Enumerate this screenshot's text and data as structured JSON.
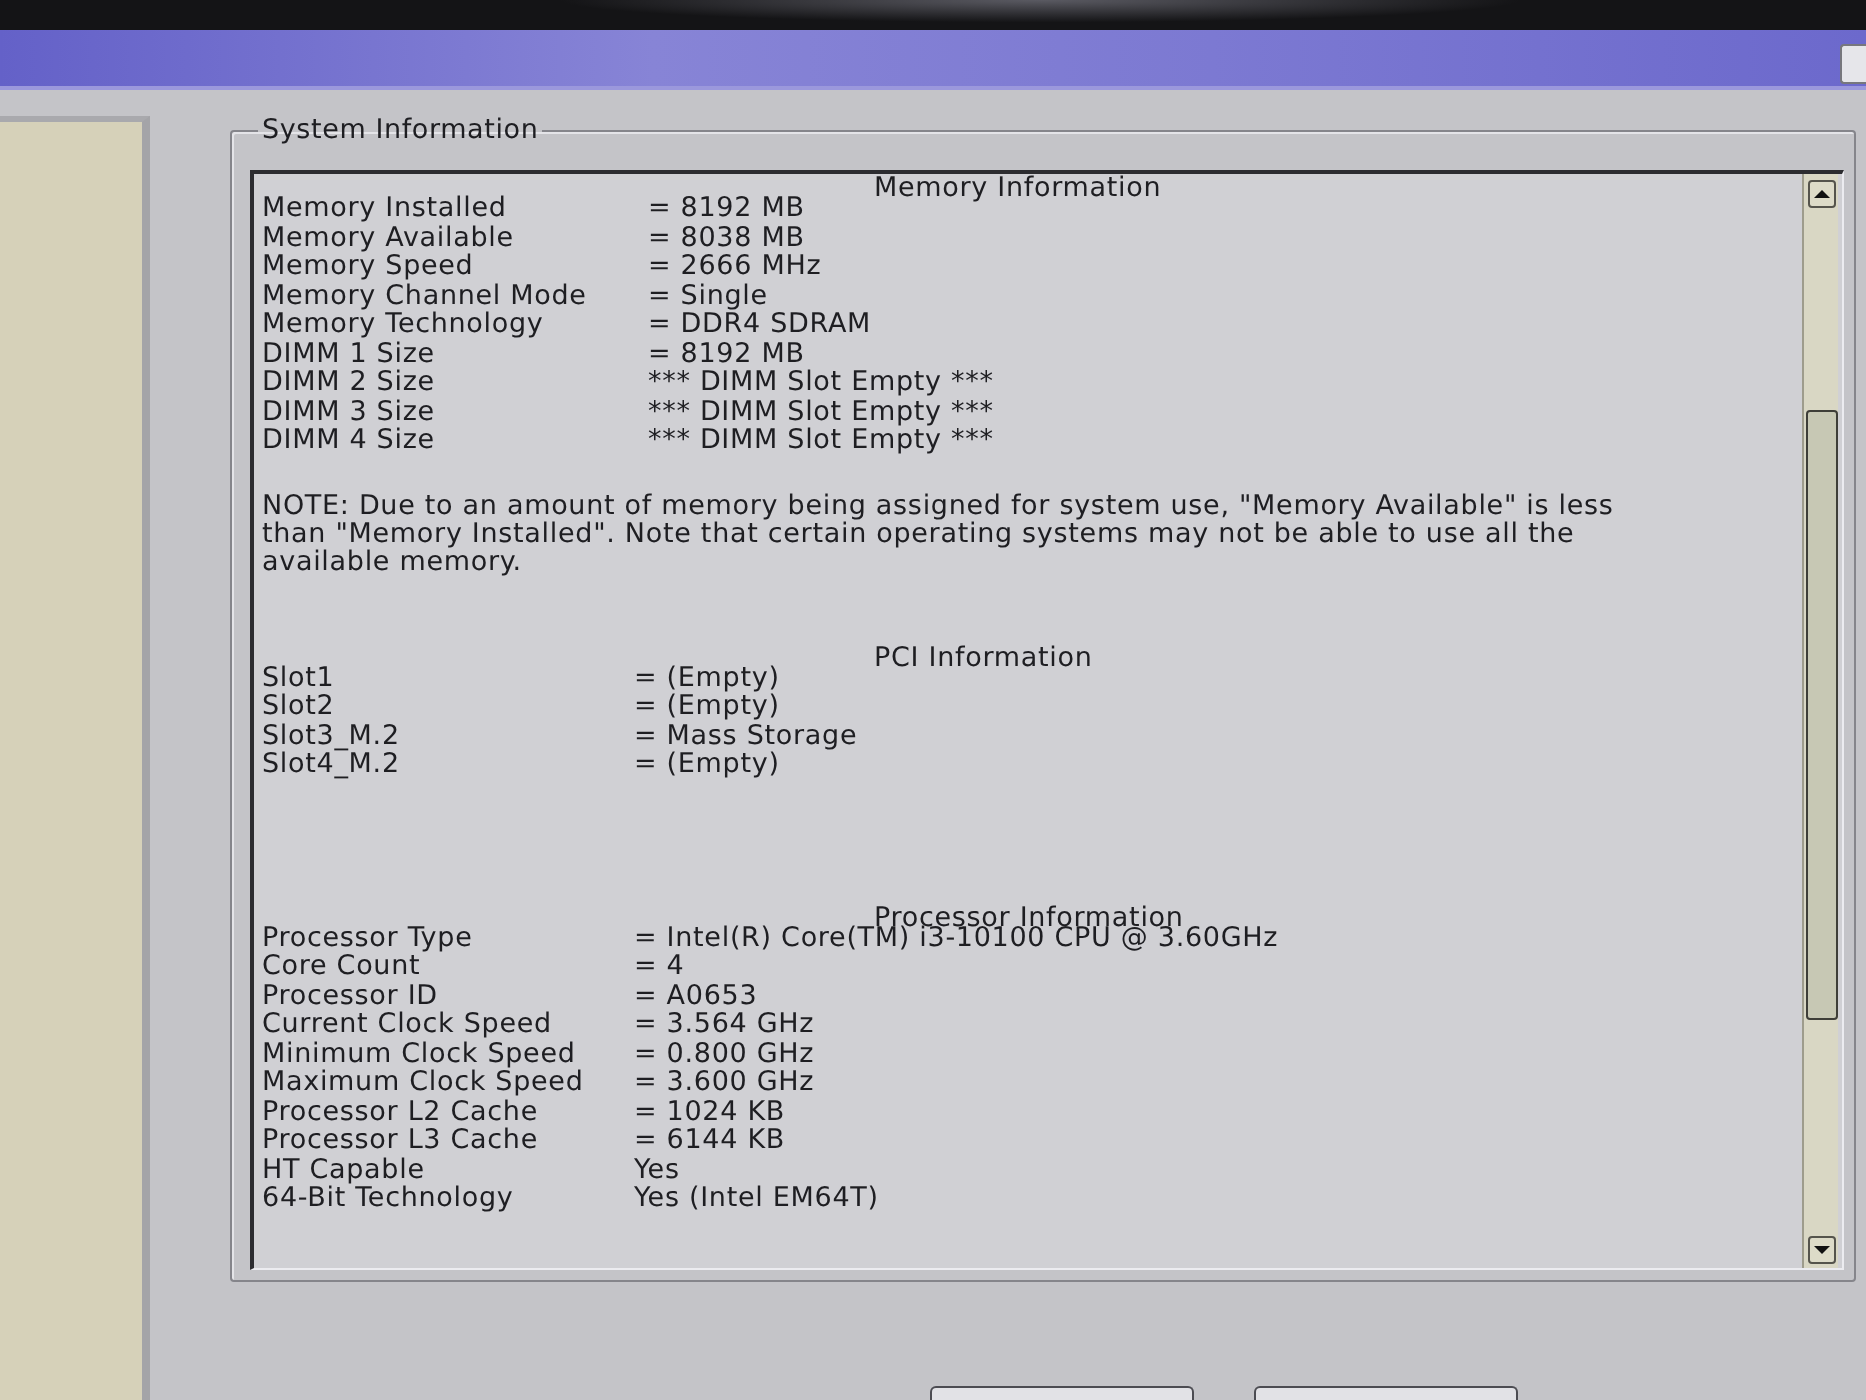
{
  "group": {
    "title": "System Information"
  },
  "sections": [
    {
      "kind": "table",
      "heading": "Memory Information",
      "rows": [
        {
          "label": "Memory Installed",
          "value": "= 8192 MB"
        },
        {
          "label": "Memory Available",
          "value": "= 8038 MB"
        },
        {
          "label": "Memory Speed",
          "value": "= 2666 MHz"
        },
        {
          "label": "Memory Channel Mode",
          "value": "= Single"
        },
        {
          "label": "Memory Technology",
          "value": "= DDR4 SDRAM"
        },
        {
          "label": "DIMM 1 Size",
          "value": "= 8192 MB"
        },
        {
          "label": "DIMM 2 Size",
          "value": "*** DIMM Slot Empty ***"
        },
        {
          "label": "DIMM 3 Size",
          "value": "*** DIMM Slot Empty ***"
        },
        {
          "label": "DIMM 4 Size",
          "value": "*** DIMM Slot Empty ***"
        }
      ]
    },
    {
      "kind": "note",
      "text": "NOTE: Due to an amount of memory being assigned for system use, \"Memory Available\" is less than \"Memory Installed\". Note that certain operating systems may not be able to use all the available memory."
    },
    {
      "kind": "table",
      "heading": "PCI Information",
      "rows": [
        {
          "label": "Slot1",
          "value": "= (Empty)"
        },
        {
          "label": "Slot2",
          "value": "= (Empty)"
        },
        {
          "label": "Slot3_M.2",
          "value": "= Mass Storage"
        },
        {
          "label": "Slot4_M.2",
          "value": "= (Empty)"
        }
      ]
    },
    {
      "kind": "table",
      "heading": "Processor Information",
      "rows": [
        {
          "label": "Processor Type",
          "value": "= Intel(R) Core(TM) i3-10100 CPU @ 3.60GHz"
        },
        {
          "label": "Core Count",
          "value": "= 4"
        },
        {
          "label": "Processor ID",
          "value": "= A0653"
        },
        {
          "label": "Current Clock Speed",
          "value": "= 3.564 GHz"
        },
        {
          "label": "Minimum Clock Speed",
          "value": "= 0.800 GHz"
        },
        {
          "label": "Maximum Clock Speed",
          "value": "= 3.600 GHz"
        },
        {
          "label": "Processor L2 Cache",
          "value": "= 1024 KB"
        },
        {
          "label": "Processor L3 Cache",
          "value": "= 6144 KB"
        },
        {
          "label": "HT Capable",
          "value": "Yes"
        },
        {
          "label": "64-Bit Technology",
          "value": "Yes (Intel EM64T)"
        }
      ]
    }
  ]
}
